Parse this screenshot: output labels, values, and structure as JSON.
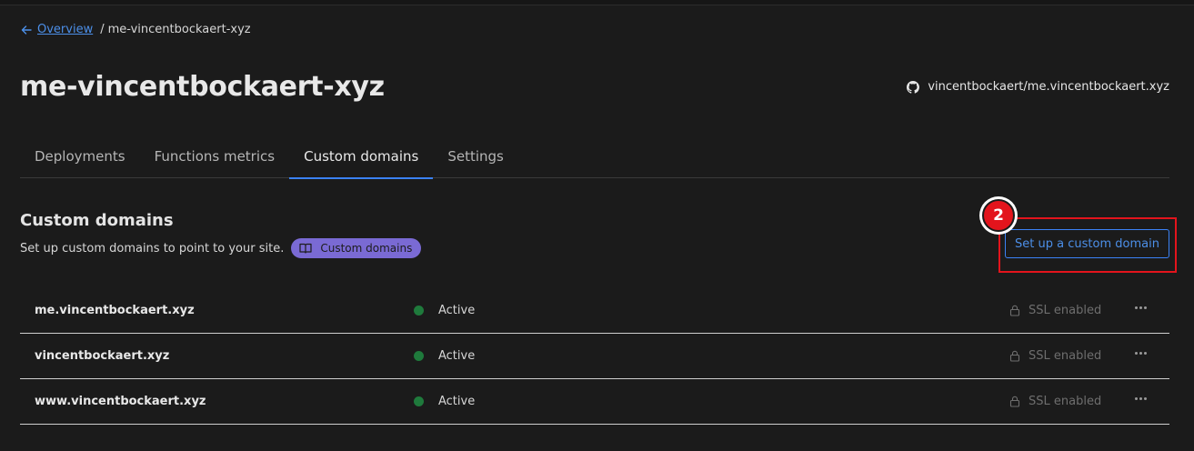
{
  "breadcrumb": {
    "overview": "Overview",
    "separator": "/",
    "current": "me-vincentbockaert-xyz"
  },
  "page": {
    "title": "me-vincentbockaert-xyz"
  },
  "repo": {
    "name": "vincentbockaert/me.vincentbockaert.xyz",
    "icon": "github-icon"
  },
  "tabs": [
    {
      "label": "Deployments",
      "active": false
    },
    {
      "label": "Functions metrics",
      "active": false
    },
    {
      "label": "Custom domains",
      "active": true
    },
    {
      "label": "Settings",
      "active": false
    }
  ],
  "section": {
    "title": "Custom domains",
    "description": "Set up custom domains to point to your site.",
    "doc_pill": "Custom domains"
  },
  "actions": {
    "setup_label": "Set up a custom domain"
  },
  "annotation": {
    "step": "2"
  },
  "domains": [
    {
      "name": "me.vincentbockaert.xyz",
      "status": "Active",
      "ssl": "SSL enabled"
    },
    {
      "name": "vincentbockaert.xyz",
      "status": "Active",
      "ssl": "SSL enabled"
    },
    {
      "name": "www.vincentbockaert.xyz",
      "status": "Active",
      "ssl": "SSL enabled"
    }
  ],
  "colors": {
    "accent": "#3b82f6",
    "status_active": "#1f7a3c",
    "annotation_red": "#e3141c",
    "pill": "#7a6ad4"
  }
}
